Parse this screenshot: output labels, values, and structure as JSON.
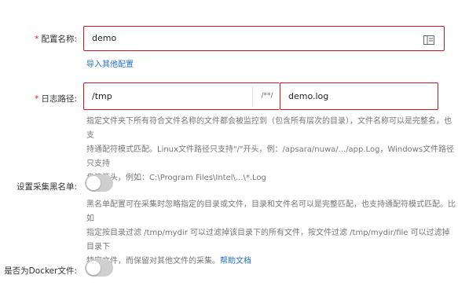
{
  "config_name": {
    "label": "配置名称:",
    "value": "demo",
    "import_link": "导入其他配置",
    "icon": "list-icon"
  },
  "log_path": {
    "label": "日志路径:",
    "directory": "/tmp",
    "separator": "/**/",
    "filename": "demo.log",
    "help_lines": [
      "指定文件夹下所有符合文件名称的文件都会被监控到（包含所有层次的目录），文件名称可以是完整名，也支",
      "持通配符模式匹配。Linux文件路径只支持\"/\"开头，例：/apsara/nuwa/.../app.Log，Windows文件路径只支持",
      "盘符开头，例如：C:\\Program Files\\Intel\\...\\*.Log"
    ]
  },
  "blacklist": {
    "label": "设置采集黑名单:",
    "enabled": false,
    "help_lines": [
      "黑名单配置可在采集时忽略指定的目录或文件，目录和文件名可以是完整匹配，也支持通配符模式匹配。比如",
      "指定按目录过滤 /tmp/mydir 可以过滤掉该目录下的所有文件，按文件过滤 /tmp/mydir/file 可以过滤掉目录下",
      "特定文件，而保留对其他文件的采集。"
    ],
    "help_link": "帮助文档"
  },
  "docker": {
    "label": "是否为Docker文件:",
    "enabled": false
  },
  "colors": {
    "required": "#e0222a",
    "highlight_border": "#c8191f",
    "link": "#1f6fd6"
  }
}
